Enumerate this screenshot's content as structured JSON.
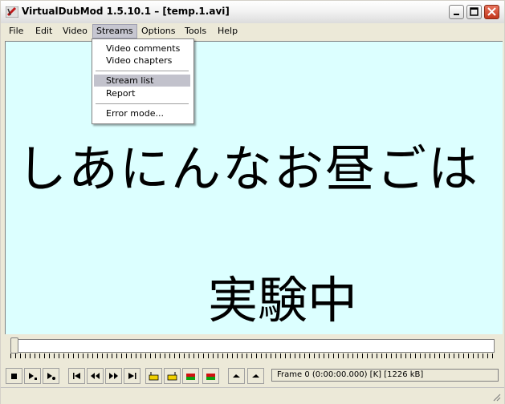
{
  "window": {
    "title": "VirtualDubMod 1.5.10.1 – [temp.1.avi]"
  },
  "menubar": {
    "file": "File",
    "edit": "Edit",
    "video": "Video",
    "streams": "Streams",
    "options": "Options",
    "tools": "Tools",
    "help": "Help"
  },
  "streams_menu": {
    "video_comments": "Video comments",
    "video_chapters": "Video chapters",
    "stream_list": "Stream list",
    "report": "Report",
    "error_mode": "Error mode..."
  },
  "video": {
    "line1": "しあにんなお昼ごは",
    "line2": "実験中"
  },
  "status": {
    "frame_info": "Frame 0 (0:00:00.000) [K] [1226 kB]"
  },
  "colors": {
    "video_bg": "#dcffff",
    "menu_selected": "#c2c2cc",
    "close_button": "#c2351a"
  }
}
